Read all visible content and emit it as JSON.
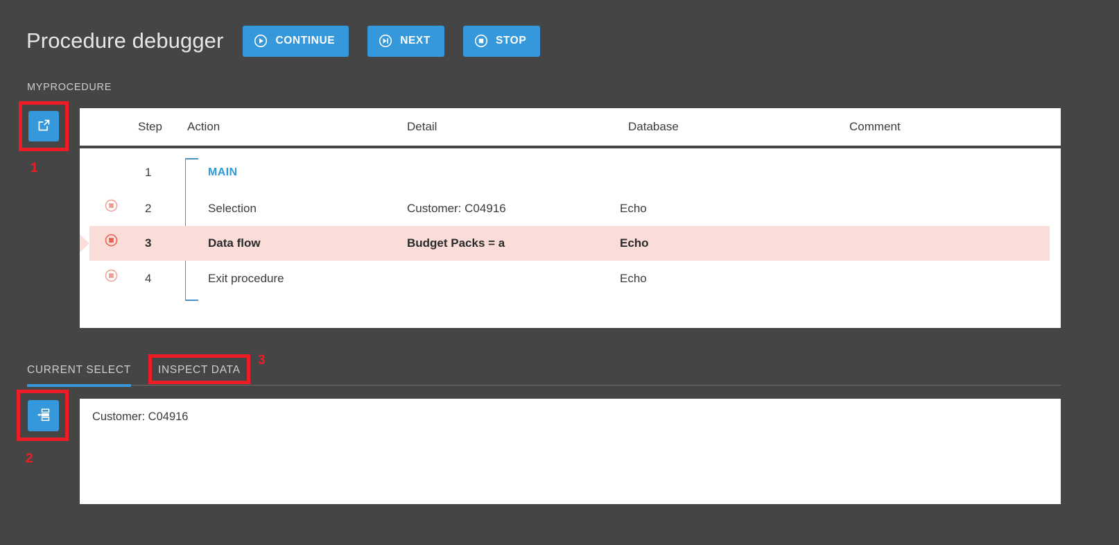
{
  "header": {
    "title": "Procedure debugger",
    "buttons": [
      {
        "label": "CONTINUE",
        "icon": "play-circle-icon"
      },
      {
        "label": "NEXT",
        "icon": "skip-next-circle-icon"
      },
      {
        "label": "STOP",
        "icon": "stop-circle-icon"
      }
    ]
  },
  "procedure": {
    "name": "MYPROCEDURE"
  },
  "side_buttons": {
    "open_external": {
      "icon": "external-link-icon",
      "annotation": "1"
    },
    "inspect_data": {
      "icon": "data-bars-icon",
      "annotation": "2"
    }
  },
  "table": {
    "columns": [
      "Step",
      "Action",
      "Detail",
      "Database",
      "Comment"
    ],
    "rows": [
      {
        "breakpoint": false,
        "step": "1",
        "action": "MAIN",
        "detail": "",
        "database": "",
        "comment": "",
        "is_label": true,
        "current": false
      },
      {
        "breakpoint": true,
        "step": "2",
        "action": "Selection",
        "detail": "Customer: C04916",
        "database": "Echo",
        "comment": "",
        "is_label": false,
        "current": false
      },
      {
        "breakpoint": true,
        "step": "3",
        "action": "Data flow",
        "detail": "Budget Packs = a",
        "database": "Echo",
        "comment": "",
        "is_label": false,
        "current": true
      },
      {
        "breakpoint": true,
        "step": "4",
        "action": "Exit procedure",
        "detail": "",
        "database": "Echo",
        "comment": "",
        "is_label": false,
        "current": false
      }
    ]
  },
  "tabs": [
    {
      "label": "CURRENT SELECT",
      "active": true
    },
    {
      "label": "INSPECT DATA",
      "active": false,
      "annotation": "3"
    }
  ],
  "content": {
    "text": "Customer: C04916"
  },
  "colors": {
    "background": "#454545",
    "accent": "#3498db",
    "panel": "#ffffff",
    "highlight_row": "#fadcd9",
    "breakpoint": "#e8604d",
    "annotation": "#ee1c25",
    "scope_bracket": "#4a90c4",
    "label_main": "#2e9bd6"
  }
}
